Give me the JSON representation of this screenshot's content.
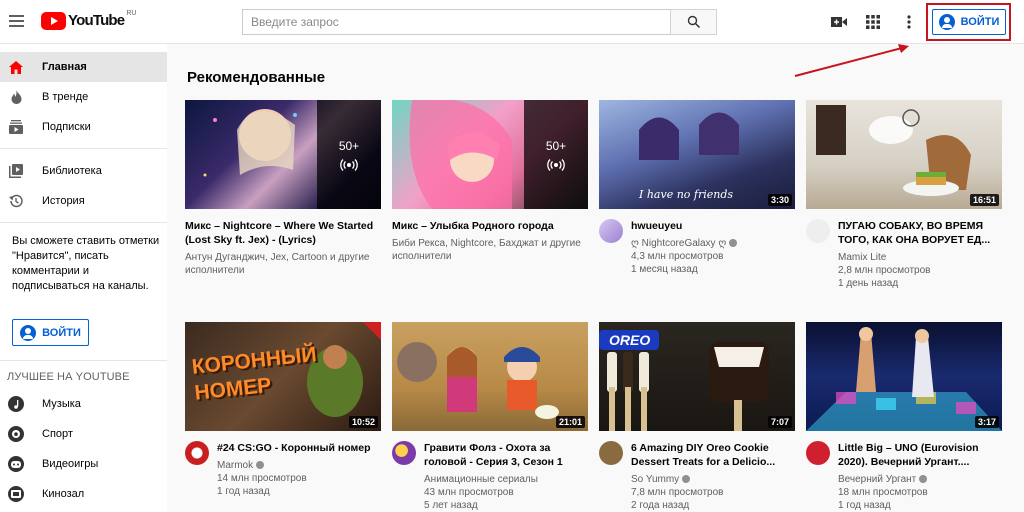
{
  "header": {
    "logo_text": "YouTube",
    "logo_country": "RU",
    "search_placeholder": "Введите запрос",
    "signin_label": "ВОЙТИ"
  },
  "sidebar": {
    "items": [
      {
        "label": "Главная",
        "icon": "home-icon"
      },
      {
        "label": "В тренде",
        "icon": "fire-icon"
      },
      {
        "label": "Подписки",
        "icon": "subscriptions-icon"
      },
      {
        "label": "Библиотека",
        "icon": "library-icon"
      },
      {
        "label": "История",
        "icon": "history-icon"
      }
    ],
    "note": "Вы сможете ставить отметки \"Нравится\", писать комментарии и подписываться на каналы.",
    "signin_label": "ВОЙТИ",
    "best_heading": "ЛУЧШЕЕ НА YOUTUBE",
    "best_items": [
      {
        "label": "Музыка",
        "icon": "music-icon"
      },
      {
        "label": "Спорт",
        "icon": "sport-icon"
      },
      {
        "label": "Видеоигры",
        "icon": "gaming-icon"
      },
      {
        "label": "Кинозал",
        "icon": "movies-icon"
      }
    ]
  },
  "main": {
    "section_title": "Рекомендованные",
    "videos": [
      {
        "title": "Микс – Nightcore – Where We Started (Lost Sky ft. Jex) - (Lyrics)",
        "channel": "Антун Дуганджич, Jex, Cartoon и другие исполнители",
        "mix_count": "50+"
      },
      {
        "title": "Микс – Улыбка Родного города",
        "channel": "Биби Рекса, Nightcore, Бахджат и другие исполнители",
        "mix_count": "50+"
      },
      {
        "title": "hwueuyeu",
        "channel": "ღ NightcoreGalaxy ღ",
        "views": "4,3 млн просмотров",
        "age": "1 месяц назад",
        "duration": "3:30",
        "thumb_text": "I have no friends"
      },
      {
        "title": "ПУГАЮ СОБАКУ, ВО ВРЕМЯ ТОГО, КАК ОНА ВОРУЕТ ЕД...",
        "channel": "Mamix Lite",
        "views": "2,8 млн просмотров",
        "age": "1 день назад",
        "duration": "16:51"
      },
      {
        "title": "#24 CS:GO - Коронный номер",
        "channel": "Marmok",
        "views": "14 млн просмотров",
        "age": "1 год назад",
        "duration": "10:52",
        "thumb_text": "КОРОННЫЙ НОМЕР"
      },
      {
        "title": "Гравити Фолз - Охота за головой - Серия 3, Сезон 1",
        "channel": "Анимационные сериалы",
        "views": "43 млн просмотров",
        "age": "5 лет назад",
        "duration": "21:01"
      },
      {
        "title": "6 Amazing DIY Oreo Cookie Dessert Treats for a Delicio...",
        "channel": "So Yummy",
        "views": "7,8 млн просмотров",
        "age": "2 года назад",
        "duration": "7:07",
        "thumb_text": "OREO"
      },
      {
        "title": "Little Big – UNO (Eurovision 2020). Вечерний Ургант....",
        "channel": "Вечерний Ургант",
        "views": "18 млн просмотров",
        "age": "1 год назад",
        "duration": "3:17"
      }
    ]
  }
}
